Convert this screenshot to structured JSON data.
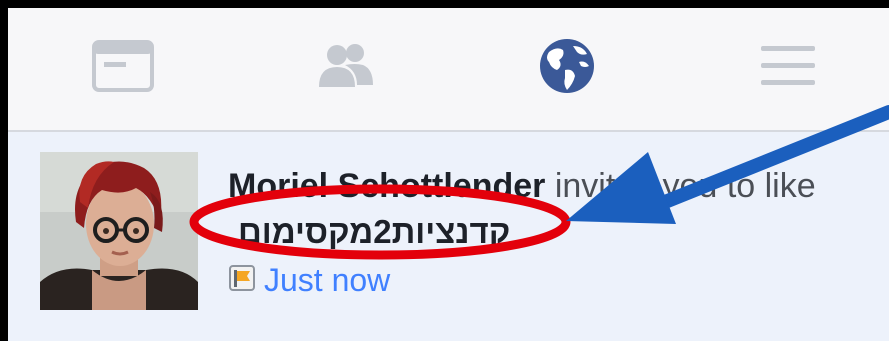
{
  "navbar": {
    "items": [
      {
        "icon": "news-feed-icon"
      },
      {
        "icon": "friends-icon"
      },
      {
        "icon": "globe-notifications-icon",
        "active": true
      },
      {
        "icon": "menu-icon"
      }
    ],
    "active_color": "#3b5998",
    "inactive_color": "#c5c9d0"
  },
  "notification": {
    "sender": "Moriel Schottlender",
    "action": " invited you to like",
    "page_name": "קדנציות2מקסימום",
    "time": "Just now",
    "badge_icon": "page-flag-icon"
  },
  "annotation": {
    "circle_color": "#e3000b",
    "arrow_color": "#1b5fbe"
  }
}
